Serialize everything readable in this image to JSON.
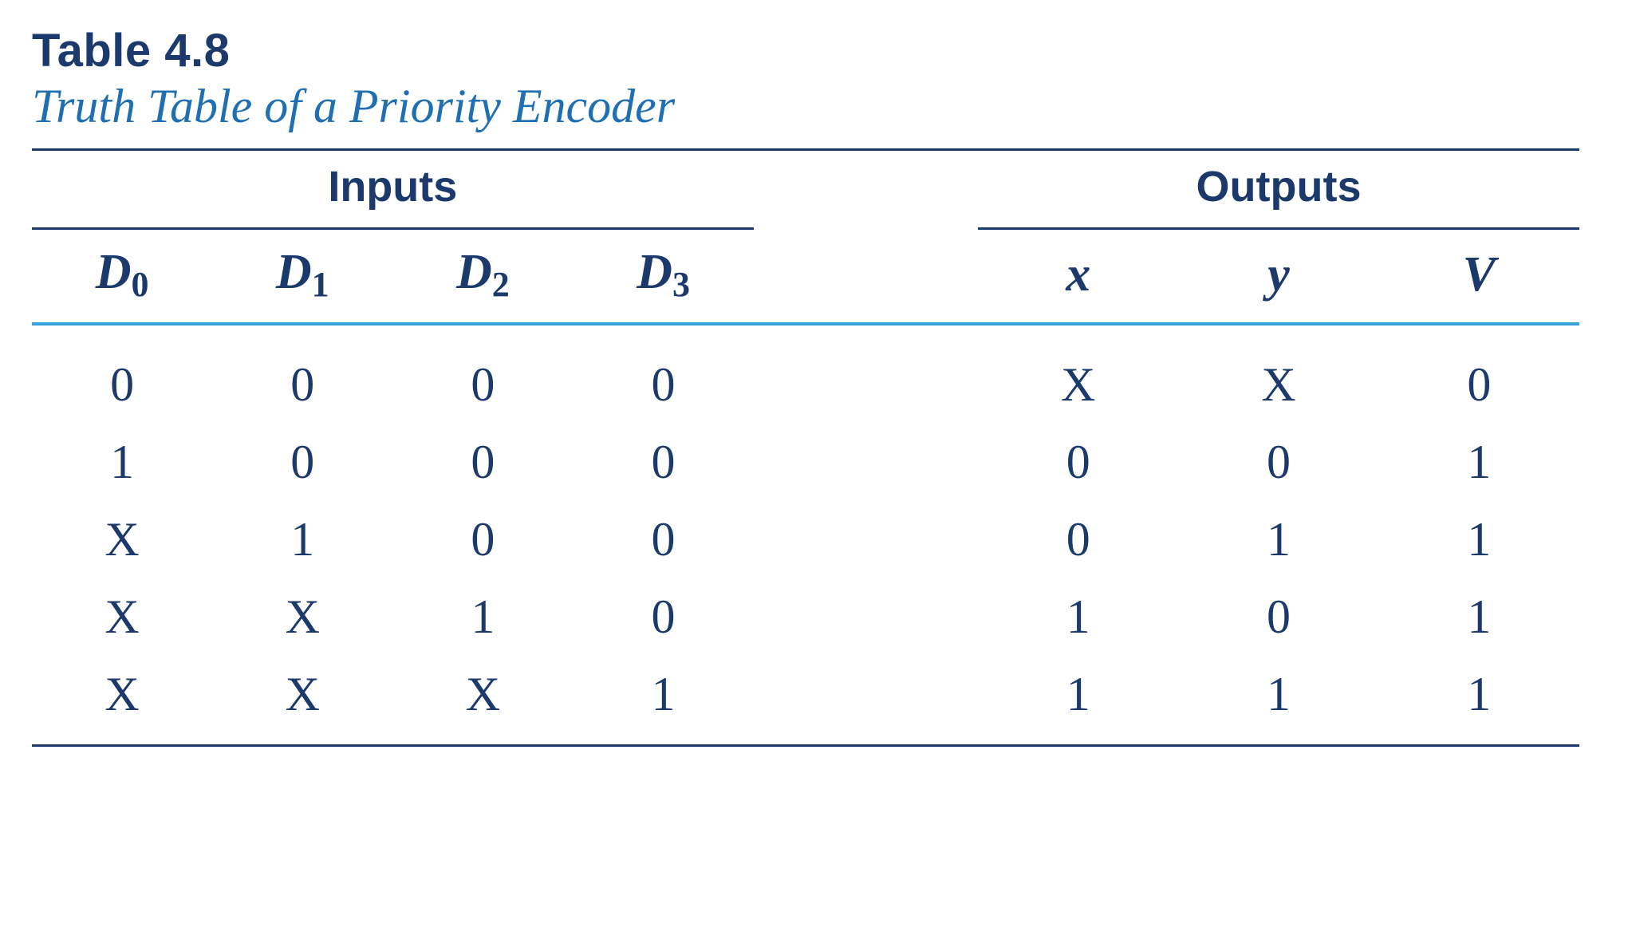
{
  "caption": {
    "number": "Table 4.8",
    "title": "Truth Table of a Priority Encoder"
  },
  "groups": {
    "inputs": "Inputs",
    "outputs": "Outputs"
  },
  "columns": {
    "d0": {
      "base": "D",
      "sub": "0"
    },
    "d1": {
      "base": "D",
      "sub": "1"
    },
    "d2": {
      "base": "D",
      "sub": "2"
    },
    "d3": {
      "base": "D",
      "sub": "3"
    },
    "x": "x",
    "y": "y",
    "v": "V"
  },
  "rows": [
    {
      "d0": "0",
      "d1": "0",
      "d2": "0",
      "d3": "0",
      "x": "X",
      "y": "X",
      "v": "0"
    },
    {
      "d0": "1",
      "d1": "0",
      "d2": "0",
      "d3": "0",
      "x": "0",
      "y": "0",
      "v": "1"
    },
    {
      "d0": "X",
      "d1": "1",
      "d2": "0",
      "d3": "0",
      "x": "0",
      "y": "1",
      "v": "1"
    },
    {
      "d0": "X",
      "d1": "X",
      "d2": "1",
      "d3": "0",
      "x": "1",
      "y": "0",
      "v": "1"
    },
    {
      "d0": "X",
      "d1": "X",
      "d2": "X",
      "d3": "1",
      "x": "1",
      "y": "1",
      "v": "1"
    }
  ],
  "chart_data": {
    "type": "table",
    "title": "Table 4.8 — Truth Table of a Priority Encoder",
    "columns": [
      "D0",
      "D1",
      "D2",
      "D3",
      "x",
      "y",
      "V"
    ],
    "rows": [
      [
        "0",
        "0",
        "0",
        "0",
        "X",
        "X",
        "0"
      ],
      [
        "1",
        "0",
        "0",
        "0",
        "0",
        "0",
        "1"
      ],
      [
        "X",
        "1",
        "0",
        "0",
        "0",
        "1",
        "1"
      ],
      [
        "X",
        "X",
        "1",
        "0",
        "1",
        "0",
        "1"
      ],
      [
        "X",
        "X",
        "X",
        "1",
        "1",
        "1",
        "1"
      ]
    ]
  }
}
